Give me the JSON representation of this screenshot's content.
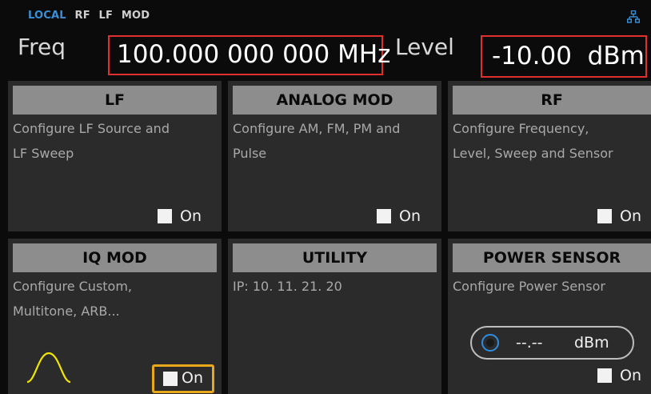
{
  "status": {
    "local": "LOCAL",
    "rf": "RF",
    "lf": "LF",
    "mod": "MOD"
  },
  "icons": {
    "network": "network-icon",
    "sine": "sine-wave-icon"
  },
  "colors": {
    "accent": "#3a8fd6",
    "highlight": "#e0302e",
    "focus": "#e9a81b",
    "sine": "#f2e600"
  },
  "freq": {
    "label": "Freq",
    "value": "100.000 000 000 MHz"
  },
  "level": {
    "label": "Level",
    "value": "-10.00  dBm"
  },
  "tiles": [
    {
      "title": "LF",
      "desc1": "Configure LF Source and",
      "desc2": "LF Sweep",
      "on": "On"
    },
    {
      "title": "ANALOG MOD",
      "desc1": "Configure AM, FM, PM and",
      "desc2": "Pulse",
      "on": "On"
    },
    {
      "title": "RF",
      "desc1": "Configure Frequency,",
      "desc2": "Level, Sweep and Sensor",
      "on": "On"
    },
    {
      "title": "IQ MOD",
      "desc1": "Configure Custom,",
      "desc2": "Multitone, ARB...",
      "on": "On"
    },
    {
      "title": "UTILITY",
      "desc1": "IP:  10. 11. 21. 20",
      "desc2": ""
    },
    {
      "title": "POWER SENSOR",
      "desc1": "Configure Power Sensor",
      "desc2": "",
      "on": "On",
      "reading": "--.--",
      "unit": "dBm"
    }
  ]
}
